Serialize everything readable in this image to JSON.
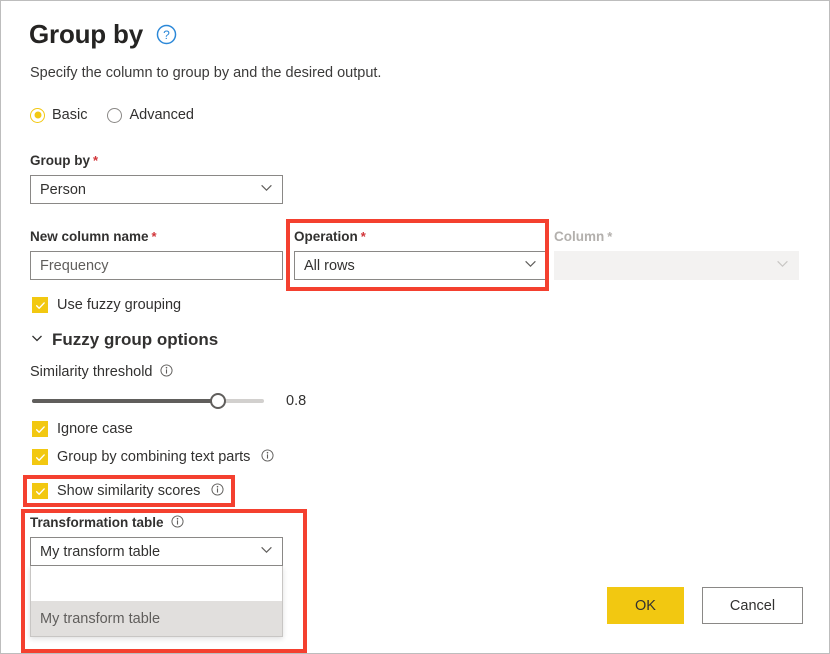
{
  "dialog": {
    "title": "Group by",
    "help_icon": "question-circle-icon",
    "subtitle": "Specify the column to group by and the desired output."
  },
  "mode": {
    "options": [
      {
        "label": "Basic",
        "selected": true
      },
      {
        "label": "Advanced",
        "selected": false
      }
    ]
  },
  "fields": {
    "group_by": {
      "label": "Group by",
      "required_marker": "*",
      "value": "Person",
      "chevron_icon": "chevron-down-icon"
    },
    "new_column_name": {
      "label": "New column name",
      "required_marker": "*",
      "value": "Frequency"
    },
    "operation": {
      "label": "Operation",
      "required_marker": "*",
      "value": "All rows",
      "chevron_icon": "chevron-down-icon"
    },
    "column": {
      "label": "Column",
      "required_marker": "*",
      "value": "",
      "disabled": true,
      "chevron_icon": "chevron-down-icon"
    }
  },
  "fuzzy": {
    "use_fuzzy_grouping": {
      "label": "Use fuzzy grouping",
      "checked": true
    },
    "options_header": {
      "label": "Fuzzy group options",
      "caret_icon": "chevron-down-icon",
      "expanded": true
    },
    "similarity_threshold": {
      "label": "Similarity threshold",
      "info_icon": "info-circle-icon",
      "value": "0.8",
      "percent": 80
    },
    "ignore_case": {
      "label": "Ignore case",
      "checked": true
    },
    "group_by_combining_text_parts": {
      "label": "Group by combining text parts",
      "info_icon": "info-circle-icon",
      "checked": true
    },
    "show_similarity_scores": {
      "label": "Show similarity scores",
      "info_icon": "info-circle-icon",
      "checked": true
    },
    "transformation_table": {
      "label": "Transformation table",
      "info_icon": "info-circle-icon",
      "value": "My transform table",
      "chevron_icon": "chevron-down-icon",
      "open": true,
      "options": [
        {
          "label": "",
          "selected": false
        },
        {
          "label": "My transform table",
          "selected": true
        }
      ]
    }
  },
  "buttons": {
    "ok": "OK",
    "cancel": "Cancel"
  },
  "colors": {
    "accent_yellow": "#f2c811",
    "annotation_red": "#f4402f",
    "required_red": "#d13438",
    "help_blue": "#2b88d8"
  }
}
